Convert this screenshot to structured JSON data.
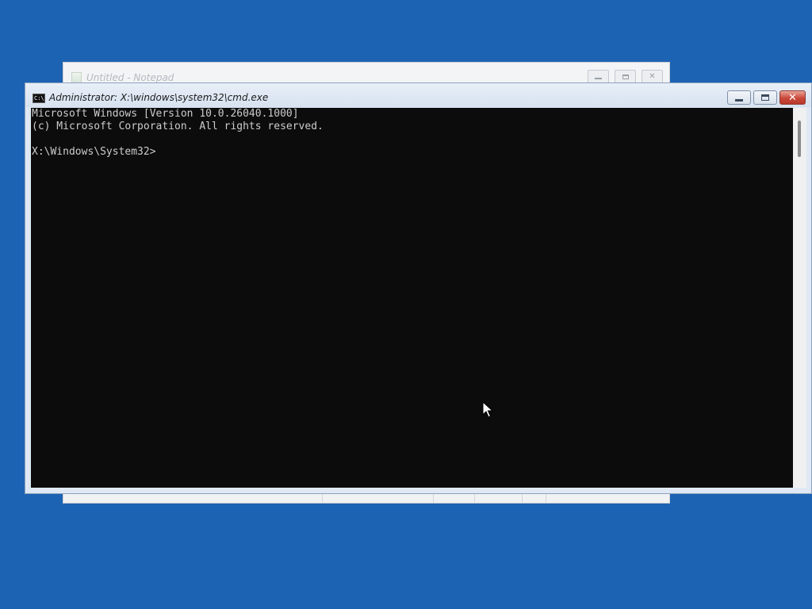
{
  "desktop": {
    "background_color": "#1d63b3"
  },
  "notepad": {
    "title": "Untitled - Notepad",
    "icon": "notepad-icon"
  },
  "cmd": {
    "title": "Administrator: X:\\windows\\system32\\cmd.exe",
    "icon_label": "C:\\",
    "lines": [
      "Microsoft Windows [Version 10.0.26040.1000]",
      "(c) Microsoft Corporation. All rights reserved.",
      "",
      "X:\\Windows\\System32>"
    ],
    "colors": {
      "console_background": "#0c0c0c",
      "console_text": "#cccccc",
      "close_button": "#c9483a"
    }
  },
  "cursor": {
    "icon": "arrow-pointer-icon"
  }
}
